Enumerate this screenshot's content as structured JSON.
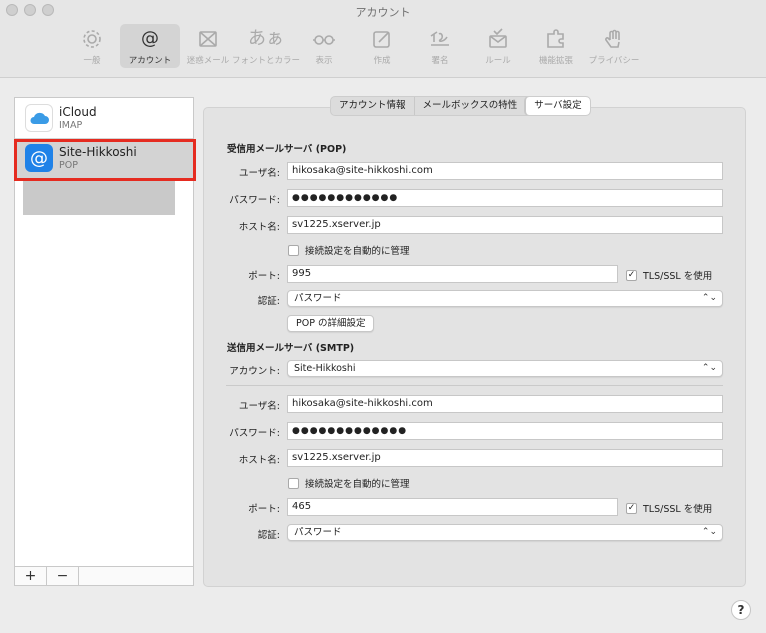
{
  "window": {
    "title": "アカウント"
  },
  "toolbar": [
    {
      "label": "一般",
      "icon": "gear-icon"
    },
    {
      "label": "アカウント",
      "icon": "at-icon"
    },
    {
      "label": "迷惑メール",
      "icon": "junk-icon"
    },
    {
      "label": "フォントとカラー",
      "icon": "fonts-icon",
      "glyph": "あぁ"
    },
    {
      "label": "表示",
      "icon": "glasses-icon"
    },
    {
      "label": "作成",
      "icon": "compose-icon"
    },
    {
      "label": "署名",
      "icon": "signature-icon"
    },
    {
      "label": "ルール",
      "icon": "rules-icon"
    },
    {
      "label": "機能拡張",
      "icon": "extension-icon"
    },
    {
      "label": "プライバシー",
      "icon": "hand-icon"
    }
  ],
  "accounts": [
    {
      "name": "iCloud",
      "type": "IMAP",
      "icon": "icloud-icon",
      "color": "#3a9be6"
    },
    {
      "name": "Site-Hikkoshi",
      "type": "POP",
      "icon": "at-icon",
      "color": "#1f82e8"
    }
  ],
  "footer": {
    "add": "+",
    "remove": "−"
  },
  "tabs": [
    "アカウント情報",
    "メールボックスの特性",
    "サーバ設定"
  ],
  "incoming": {
    "title": "受信用メールサーバ (POP)",
    "user_label": "ユーザ名:",
    "user": "hikosaka@site-hikkoshi.com",
    "pass_label": "パスワード:",
    "pass": "●●●●●●●●●●●●",
    "host_label": "ホスト名:",
    "host": "sv1225.xserver.jp",
    "auto_label": "接続設定を自動的に管理",
    "port_label": "ポート:",
    "port": "995",
    "tls_label": "TLS/SSL を使用",
    "auth_label": "認証:",
    "auth": "パスワード",
    "advanced": "POP の詳細設定"
  },
  "outgoing": {
    "title": "送信用メールサーバ (SMTP)",
    "account_label": "アカウント:",
    "account": "Site-Hikkoshi",
    "user_label": "ユーザ名:",
    "user": "hikosaka@site-hikkoshi.com",
    "pass_label": "パスワード:",
    "pass": "●●●●●●●●●●●●●",
    "host_label": "ホスト名:",
    "host": "sv1225.xserver.jp",
    "auto_label": "接続設定を自動的に管理",
    "port_label": "ポート:",
    "port": "465",
    "tls_label": "TLS/SSL を使用",
    "auth_label": "認証:",
    "auth": "パスワード"
  },
  "checks": {
    "checked": "✓"
  },
  "popup_arrow": "⌃⌄",
  "help": "?"
}
